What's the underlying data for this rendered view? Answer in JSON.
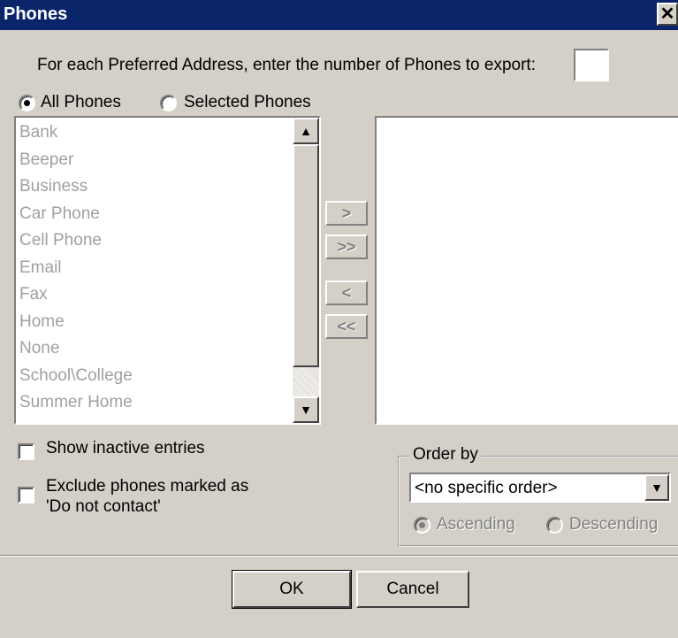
{
  "window": {
    "title": "Phones",
    "close_glyph": "✕"
  },
  "prompt": {
    "text": "For each Preferred Address, enter the number of Phones to export:",
    "value": ""
  },
  "scope": {
    "all_label": "All Phones",
    "selected_label": "Selected Phones",
    "selected": "All Phones"
  },
  "available_list": {
    "items": [
      "Bank",
      "Beeper",
      "Business",
      "Car Phone",
      "Cell Phone",
      "Email",
      "Fax",
      "Home",
      "None",
      "School\\College",
      "Summer Home"
    ]
  },
  "move_buttons": {
    "add": ">",
    "add_all": ">>",
    "remove": "<",
    "remove_all": "<<"
  },
  "options": {
    "show_inactive": {
      "label": "Show inactive entries",
      "checked": false
    },
    "exclude_dnc": {
      "label_line1": "Exclude phones marked as",
      "label_line2": "'Do not contact'",
      "checked": false
    }
  },
  "order_by": {
    "legend": "Order by",
    "selected": "<no specific order>",
    "ascending_label": "Ascending",
    "descending_label": "Descending",
    "direction": "Ascending"
  },
  "buttons": {
    "ok": "OK",
    "cancel": "Cancel"
  },
  "icons": {
    "close": "close-icon",
    "scroll_up": "scroll-up-arrow-icon",
    "scroll_down": "scroll-down-arrow-icon",
    "dropdown": "chevron-down-icon"
  },
  "colors": {
    "titlebar": "#0a246a",
    "face": "#d4d0c8",
    "disabled_text": "#a0a0a0"
  }
}
